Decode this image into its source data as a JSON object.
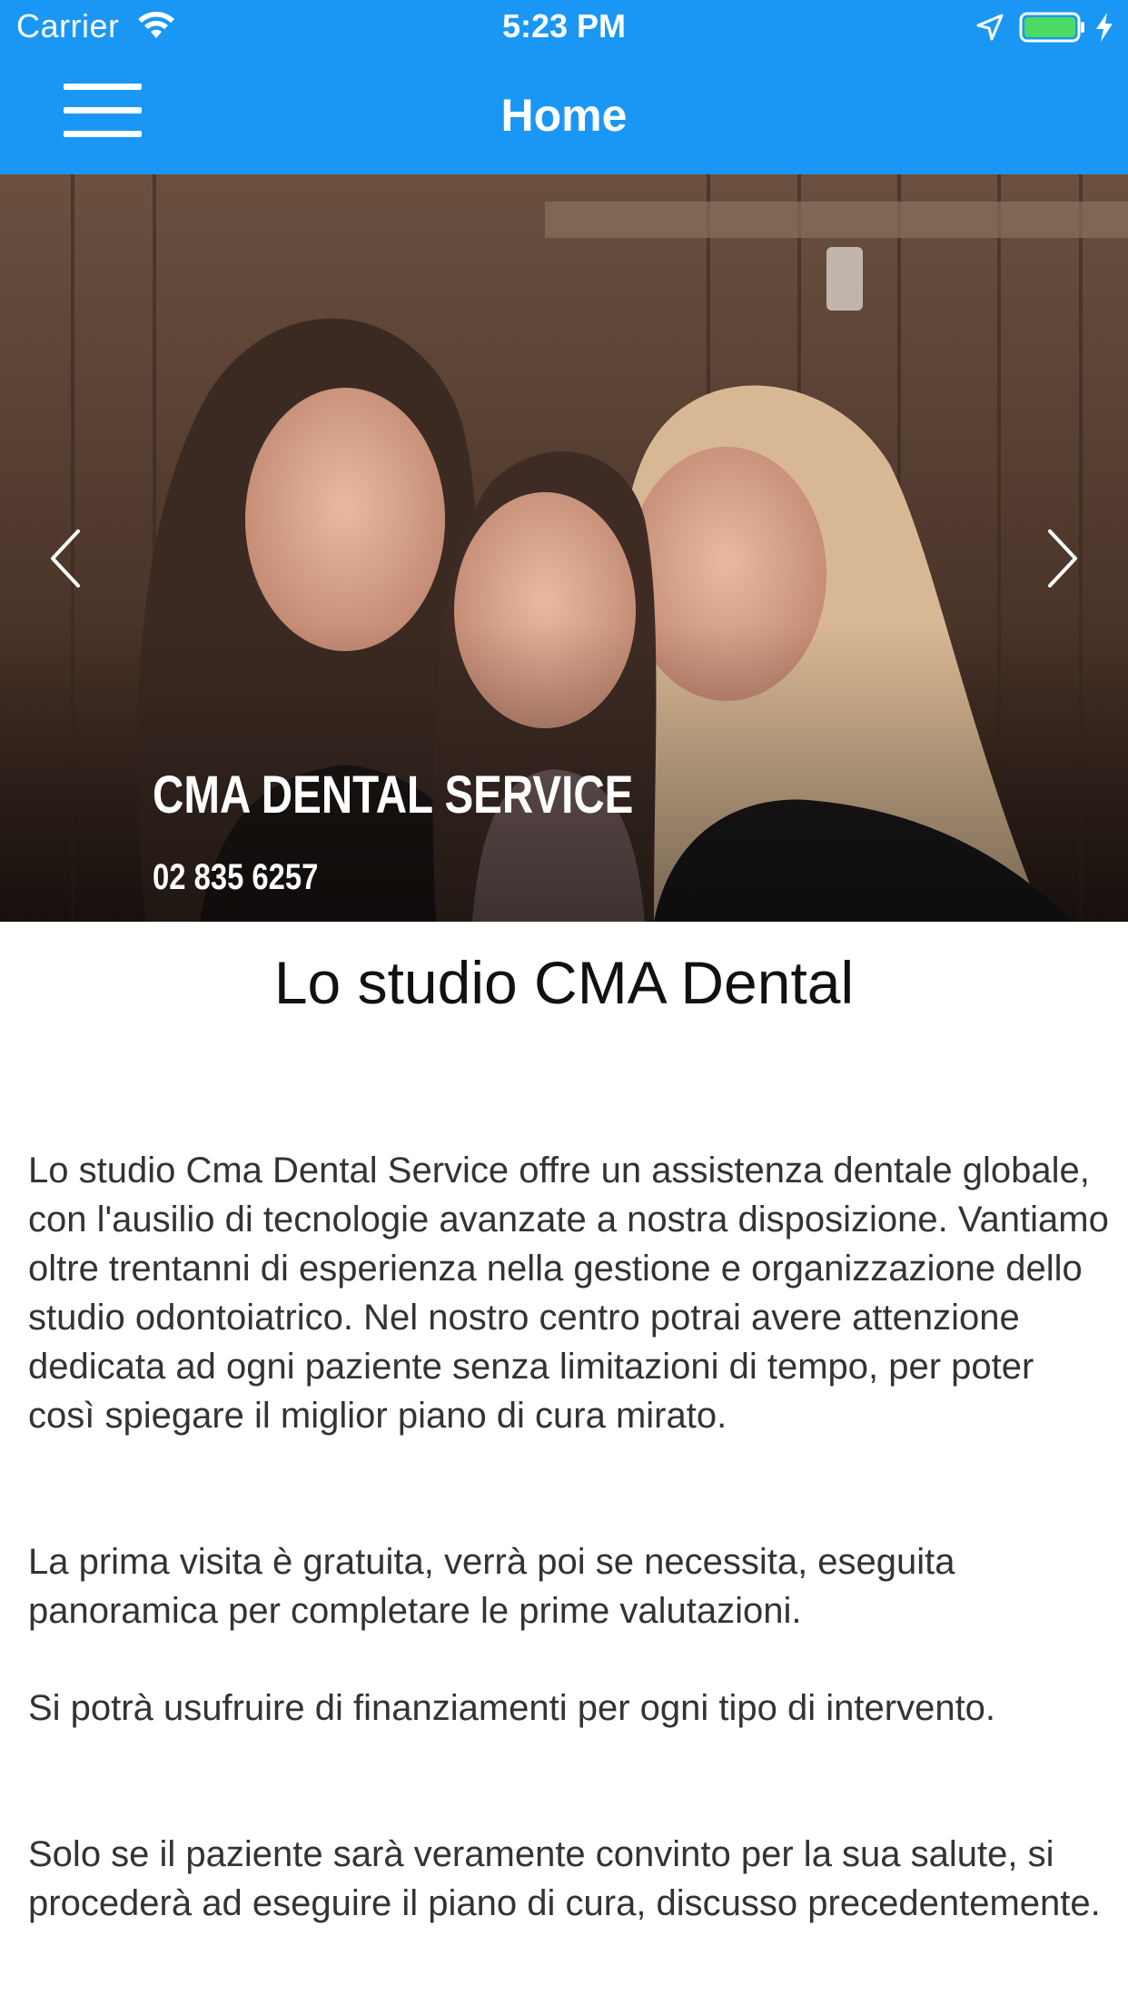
{
  "status_bar": {
    "carrier": "Carrier",
    "time": "5:23 PM",
    "icons": [
      "wifi-icon",
      "location-icon",
      "battery-icon",
      "charging-icon"
    ],
    "battery_color": "#4cd964"
  },
  "nav": {
    "title": "Home",
    "menu_icon": "hamburger-menu-icon",
    "bar_color": "#1a97f5"
  },
  "carousel": {
    "slide_title": "CMA DENTAL SERVICE",
    "slide_phone": "02 835 6257",
    "prev_icon": "chevron-left-icon",
    "next_icon": "chevron-right-icon"
  },
  "content": {
    "heading": "Lo studio CMA Dental",
    "paragraphs": [
      "Lo studio Cma Dental Service offre un assistenza dentale globale, con l'ausilio di tecnologie avanzate a nostra disposizione. Vantiamo oltre trentanni di esperienza nella gestione e organizzazione dello studio odontoiatrico. Nel nostro centro potrai avere attenzione dedicata ad ogni paziente senza limitazioni di tempo, per poter così spiegare il miglior piano di cura mirato.",
      "La prima visita è gratuita, verrà poi se necessita, eseguita panoramica per completare le prime valutazioni.",
      "Si potrà usufruire di finanziamenti per ogni tipo di intervento.",
      "Solo se il paziente sarà veramente convinto per la sua salute, si procederà ad eseguire il piano di cura, discusso precedentemente."
    ]
  }
}
